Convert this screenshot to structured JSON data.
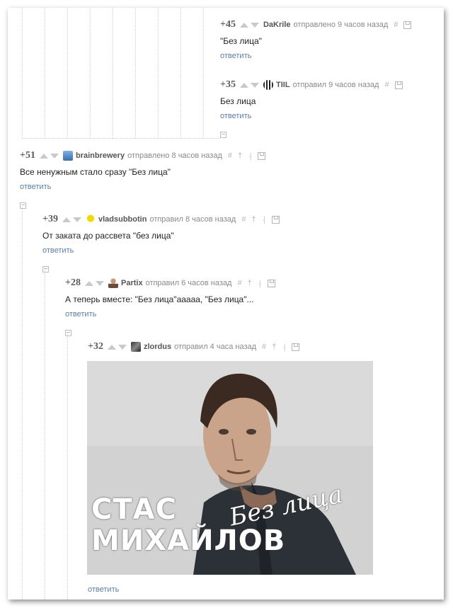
{
  "comments": [
    {
      "rating": "+45",
      "author": "DaKrile",
      "time": "отправлено 9 часов назад",
      "text": "\"Без лица\"",
      "reply": "ответить"
    },
    {
      "rating": "+35",
      "author": "TIIL",
      "time": "отправил 9 часов назад",
      "text": "Без лица",
      "reply": "ответить"
    },
    {
      "rating": "+51",
      "author": "brainbrewery",
      "time": "отправлено 8 часов назад",
      "text": "Все ненужным стало сразу \"Без лица\"",
      "reply": "ответить"
    },
    {
      "rating": "+39",
      "author": "vladsubbotin",
      "time": "отправил 8 часов назад",
      "text": "От заката до рассвета \"без лица\"",
      "reply": "ответить"
    },
    {
      "rating": "+28",
      "author": "Partix",
      "time": "отправил 6 часов назад",
      "text": "А теперь вместе: \"Без лица\"ааааа, \"Без лица\"...",
      "reply": "ответить"
    },
    {
      "rating": "+32",
      "author": "zlordus",
      "time": "отправил 4 часа назад",
      "reply": "ответить"
    }
  ],
  "image": {
    "line1": "СТАС",
    "line2": "МИХАЙЛОВ",
    "script": "Без лица"
  },
  "icons": {
    "hash": "#",
    "pin": "†",
    "tree": "⸡"
  },
  "colors": {
    "link": "#5b7ea5",
    "text": "#222222",
    "meta": "#8a8a8a",
    "arrows": "#c9c9c9"
  }
}
